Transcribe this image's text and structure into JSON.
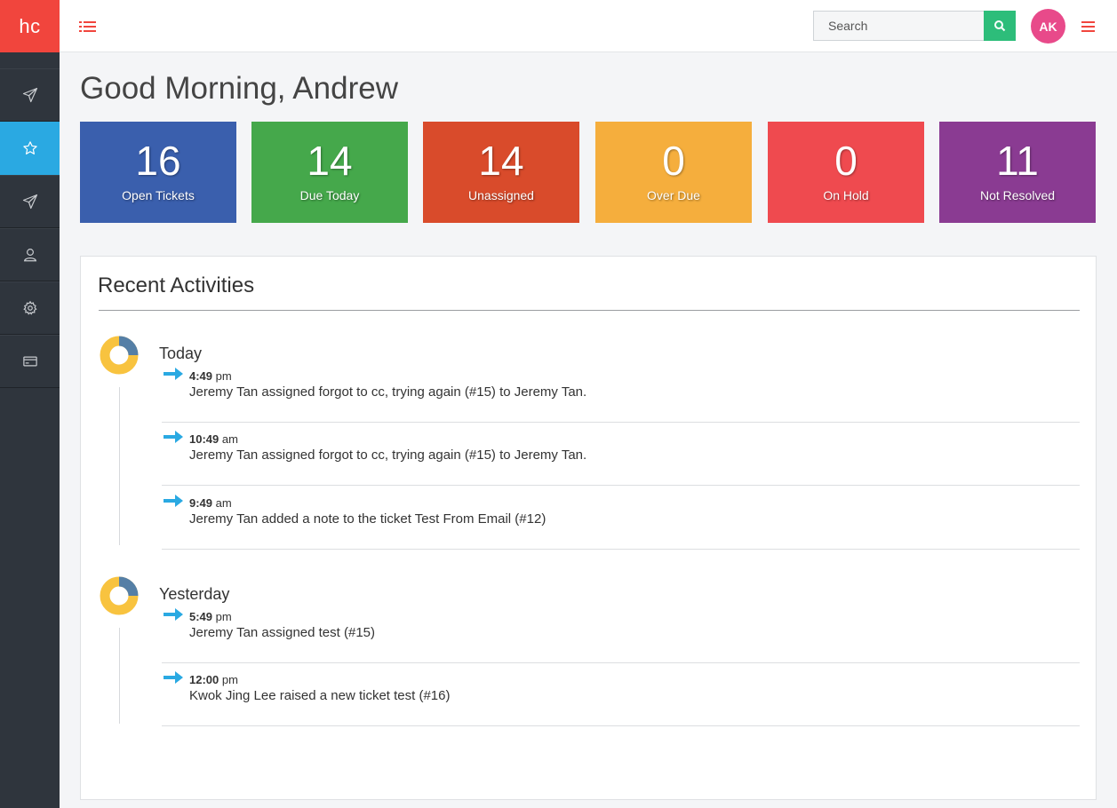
{
  "app": {
    "logo": "hc"
  },
  "header": {
    "search_placeholder": "Search",
    "avatar_initials": "AK"
  },
  "greeting": "Good Morning, Andrew",
  "stats": [
    {
      "value": "16",
      "label": "Open Tickets",
      "color": "#3a5fad"
    },
    {
      "value": "14",
      "label": "Due Today",
      "color": "#45a84b"
    },
    {
      "value": "14",
      "label": "Unassigned",
      "color": "#d94b2b"
    },
    {
      "value": "0",
      "label": "Over Due",
      "color": "#f5ae3d"
    },
    {
      "value": "0",
      "label": "On Hold",
      "color": "#ef4a4f"
    },
    {
      "value": "11",
      "label": "Not Resolved",
      "color": "#8a3b92"
    }
  ],
  "activities": {
    "title": "Recent Activities",
    "days": [
      {
        "label": "Today",
        "items": [
          {
            "time": "4:49",
            "ampm": "pm",
            "text": "Jeremy Tan assigned forgot to cc, trying again (#15) to Jeremy Tan."
          },
          {
            "time": "10:49",
            "ampm": "am",
            "text": "Jeremy Tan assigned forgot to cc, trying again (#15) to Jeremy Tan."
          },
          {
            "time": "9:49",
            "ampm": "am",
            "text": "Jeremy Tan added a note to the ticket Test From Email (#12)"
          }
        ]
      },
      {
        "label": "Yesterday",
        "items": [
          {
            "time": "5:49",
            "ampm": "pm",
            "text": "Jeremy Tan assigned test (#15)"
          },
          {
            "time": "12:00",
            "ampm": "pm",
            "text": "Kwok Jing Lee raised a new ticket test (#16)"
          }
        ]
      }
    ]
  },
  "colors": {
    "brand_red": "#f1453d",
    "sidebar_bg": "#2f353d",
    "sidebar_active": "#2aa9e2",
    "search_green": "#2dbd7a",
    "avatar_pink": "#e84a8a",
    "arrow_blue": "#2aa9e2"
  },
  "icons": {
    "menu_toggle": "list-icon",
    "search": "search-icon",
    "hamburger": "hamburger-icon",
    "sidebar": [
      "paper-plane-icon",
      "star-icon",
      "paper-plane-icon",
      "user-icon",
      "gear-icon",
      "credit-card-icon"
    ],
    "activity_arrow": "arrow-right-icon",
    "day_marker": "donut-chart-icon"
  }
}
